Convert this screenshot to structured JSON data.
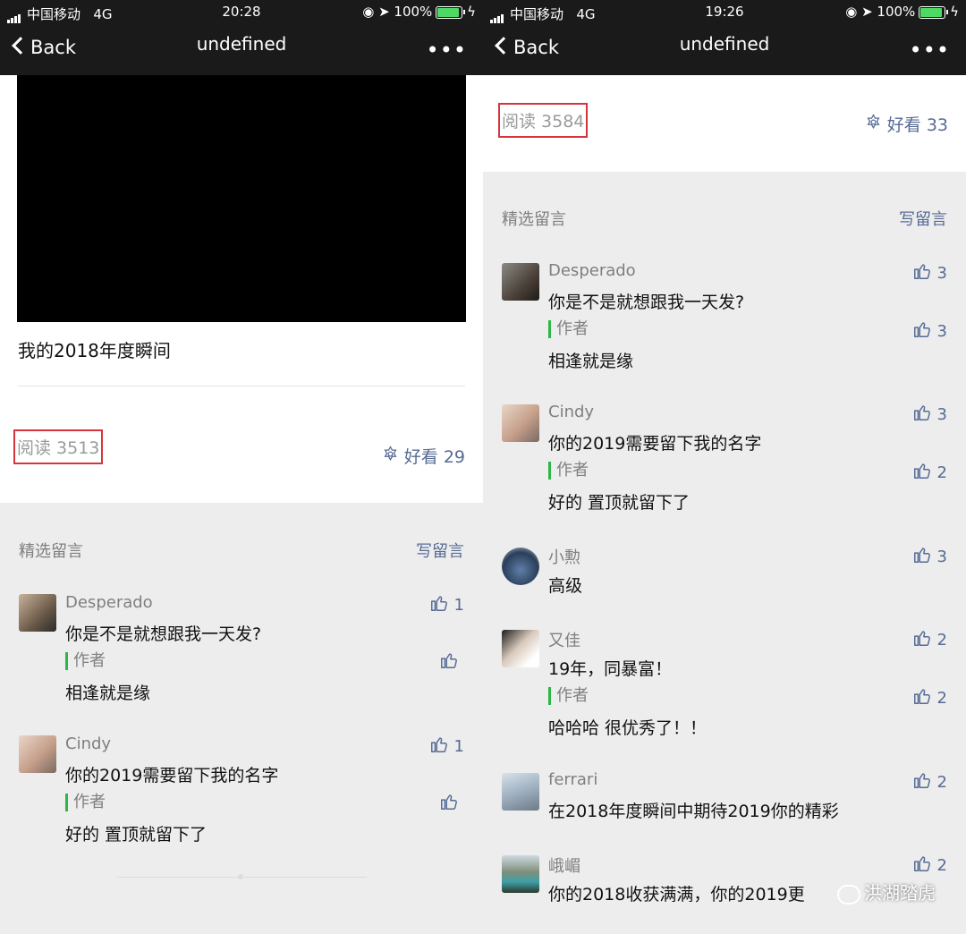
{
  "status_left": {
    "carrier": "中国移动",
    "network": "4G",
    "time": "20:28",
    "battery": "100%"
  },
  "status_right": {
    "carrier": "中国移动",
    "network": "4G",
    "time": "19:26",
    "battery": "100%"
  },
  "nav": {
    "back_label": "Back",
    "title": "undefined",
    "more_label": "•••"
  },
  "left": {
    "article_title": "我的2018年度瞬间",
    "reads": "阅读 3513",
    "likes": "好看 29",
    "section_label": "精选留言",
    "write_label": "写留言",
    "comments": [
      {
        "nick": "Desperado",
        "text": "你是不是就想跟我一天发?",
        "likes": "1",
        "author_label": "作者",
        "reply": "相逢就是缘",
        "reply_likes": ""
      },
      {
        "nick": "Cindy",
        "text": "你的2019需要留下我的名字",
        "likes": "1",
        "author_label": "作者",
        "reply": "好的 置顶就留下了",
        "reply_likes": ""
      }
    ]
  },
  "right": {
    "reads": "阅读 3584",
    "likes": "好看 33",
    "section_label": "精选留言",
    "write_label": "写留言",
    "comments": [
      {
        "nick": "Desperado",
        "text": "你是不是就想跟我一天发?",
        "likes": "3",
        "author_label": "作者",
        "reply": "相逢就是缘",
        "reply_likes": "3"
      },
      {
        "nick": "Cindy",
        "text": "你的2019需要留下我的名字",
        "likes": "3",
        "author_label": "作者",
        "reply": "好的 置顶就留下了",
        "reply_likes": "2"
      },
      {
        "nick": "小勲",
        "text": "高级",
        "likes": "3"
      },
      {
        "nick": "又佳",
        "text": "19年，同暴富！",
        "likes": "2",
        "author_label": "作者",
        "reply": "哈哈哈 很优秀了！！",
        "reply_likes": "2"
      },
      {
        "nick": "ferrari",
        "text": "在2018年度瞬间中期待2019你的精彩",
        "likes": "2"
      },
      {
        "nick": "峨嵋",
        "text": "你的2018收获满满，你的2019更",
        "likes": "2"
      }
    ]
  },
  "watermark": "洪湖踏虎",
  "colors": {
    "link": "#576b95",
    "author_bar": "#2db744",
    "highlight_box": "#d6343d",
    "battery": "#4cd964"
  }
}
